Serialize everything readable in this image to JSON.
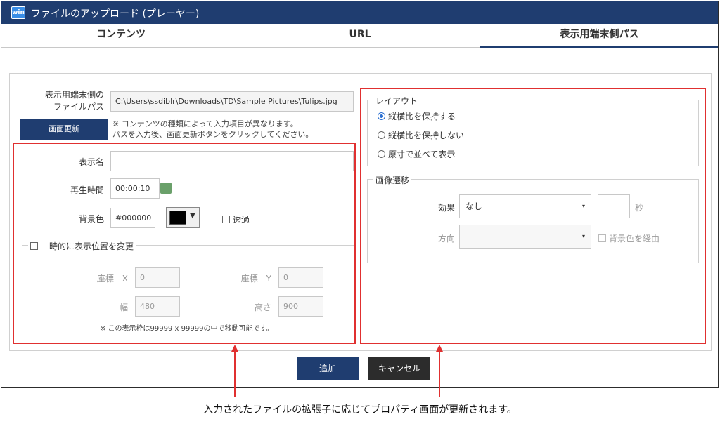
{
  "window": {
    "title": "ファイルのアップロード (プレーヤー)",
    "app_icon_text": "win"
  },
  "tabs": [
    {
      "label": "コンテンツ"
    },
    {
      "label": "URL"
    },
    {
      "label": "表示用端末側パス"
    }
  ],
  "file_path": {
    "label_line1": "表示用端末側の",
    "label_line2": "ファイルパス",
    "value": "C:\\Users\\ssdiblr\\Downloads\\TD\\Sample Pictures\\Tulips.jpg",
    "refresh_button": "画面更新",
    "note_line1": "※ コンテンツの種類によって入力項目が異なります。",
    "note_line2": "パスを入力後、画面更新ボタンをクリックしてください。"
  },
  "left_panel": {
    "display_name_label": "表示名",
    "display_name_value": "",
    "play_time_label": "再生時間",
    "play_time_value": "00:00:10",
    "bg_color_label": "背景色",
    "bg_color_value": "#000000",
    "transparent_label": "透過",
    "temp_position_label": "一時的に表示位置を変更",
    "x_label": "座標 - X",
    "x_value": "0",
    "y_label": "座標 - Y",
    "y_value": "0",
    "width_label": "幅",
    "width_value": "480",
    "height_label": "高さ",
    "height_value": "900",
    "range_note": "※ この表示枠は99999 x 99999の中で移動可能です。"
  },
  "right_panel": {
    "layout_legend": "レイアウト",
    "layout_options": [
      {
        "label": "縦横比を保持する",
        "selected": true
      },
      {
        "label": "縦横比を保持しない",
        "selected": false
      },
      {
        "label": "原寸で並べて表示",
        "selected": false
      }
    ],
    "transition_legend": "画像遷移",
    "effect_label": "効果",
    "effect_value": "なし",
    "seconds_value": "",
    "seconds_unit": "秒",
    "direction_label": "方向",
    "direction_value": "",
    "via_bg_label": "背景色を経由"
  },
  "footer": {
    "add_button": "追加",
    "cancel_button": "キャンセル"
  },
  "annotation": {
    "caption": "入力されたファイルの拡張子に応じてプロパティ画面が更新されます。"
  },
  "colors": {
    "titlebar": "#1f3d70",
    "accent": "#1f3d70",
    "highlight_box": "#e03030",
    "cancel_button": "#2c2c2c"
  }
}
